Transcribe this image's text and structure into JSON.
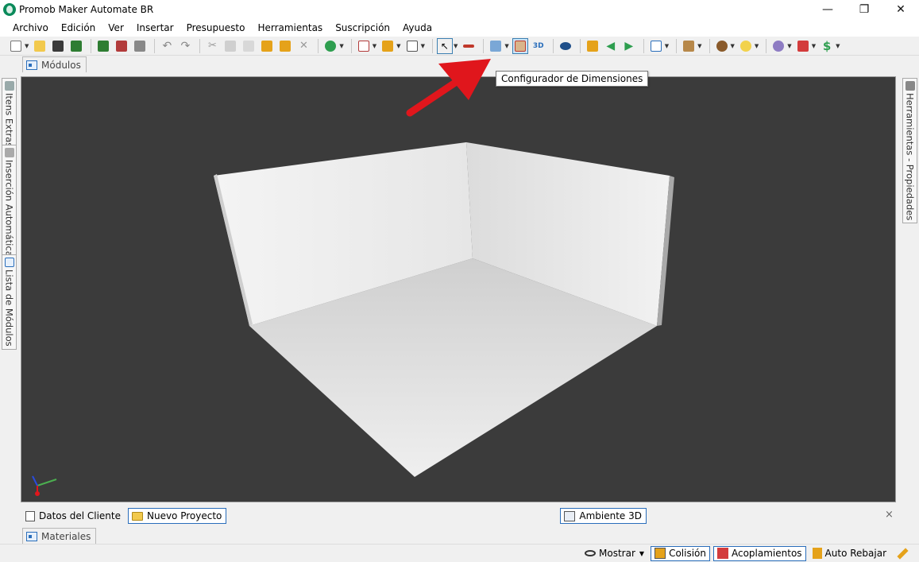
{
  "window": {
    "title": "Promob Maker Automate BR",
    "controls": {
      "minimize": "—",
      "restore": "❐",
      "close": "✕"
    }
  },
  "menu": [
    "Archivo",
    "Edición",
    "Ver",
    "Insertar",
    "Presupuesto",
    "Herramientas",
    "Suscripción",
    "Ayuda"
  ],
  "toolbar": {
    "active_tool": "configurador-dimensiones",
    "tooltip": "Configurador de Dimensiones",
    "label_3d": "3D",
    "dollar": "$"
  },
  "top_tab": {
    "label": "Módulos"
  },
  "left_tabs": [
    "Itens Extras",
    "Inserción Automática",
    "Lista de Módulos"
  ],
  "right_tabs": [
    "Herramientas - Propiedades"
  ],
  "viewport": {
    "background": "#3b3b3b"
  },
  "doc_tabs": {
    "cliente": "Datos del Cliente",
    "proyecto": "Nuevo Proyecto",
    "ambiente": "Ambiente 3D",
    "close": "×"
  },
  "bottom_tab": {
    "label": "Materiales"
  },
  "status": {
    "mostrar": "Mostrar",
    "colision": "Colisión",
    "acoplamientos": "Acoplamientos",
    "auto_rebajar": "Auto Rebajar"
  },
  "colors": {
    "accent": "#2a6ebb",
    "annotation_arrow": "#e0161c"
  }
}
